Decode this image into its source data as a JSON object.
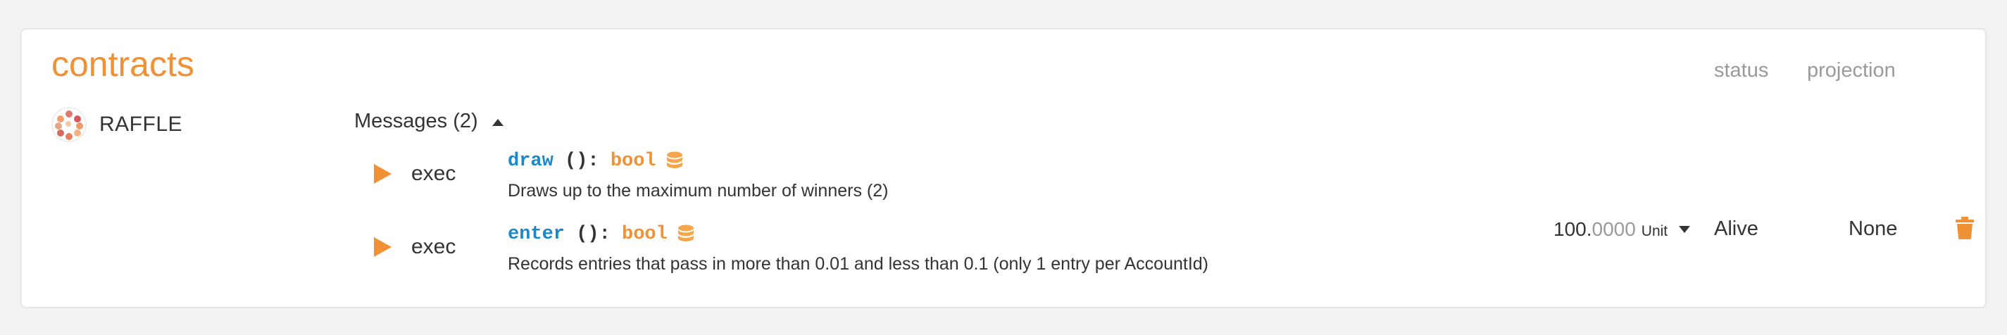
{
  "section": {
    "title": "contracts",
    "columns": {
      "status": "status",
      "projection": "projection"
    }
  },
  "contract": {
    "name": "RAFFLE",
    "messages_label": "Messages (2)",
    "messages": [
      {
        "exec_label": "exec",
        "fn_name": "draw",
        "params": " (): ",
        "return_type": "bool",
        "description": "Draws up to the maximum number of winners (2)",
        "icon": "database-icon"
      },
      {
        "exec_label": "exec",
        "fn_name": "enter",
        "params": " (): ",
        "return_type": "bool",
        "description": "Records entries that pass in more than 0.01 and less than 0.1 (only 1 entry per AccountId)",
        "icon": "database-icon"
      }
    ],
    "balance": {
      "integer": "100.",
      "fraction": "0000",
      "unit": "Unit"
    },
    "status": "Alive",
    "projection": "None"
  },
  "colors": {
    "accent": "#f19135",
    "fn_blue": "#1a88c9",
    "muted": "#9a9a9a",
    "background": "#f2f2f1"
  }
}
